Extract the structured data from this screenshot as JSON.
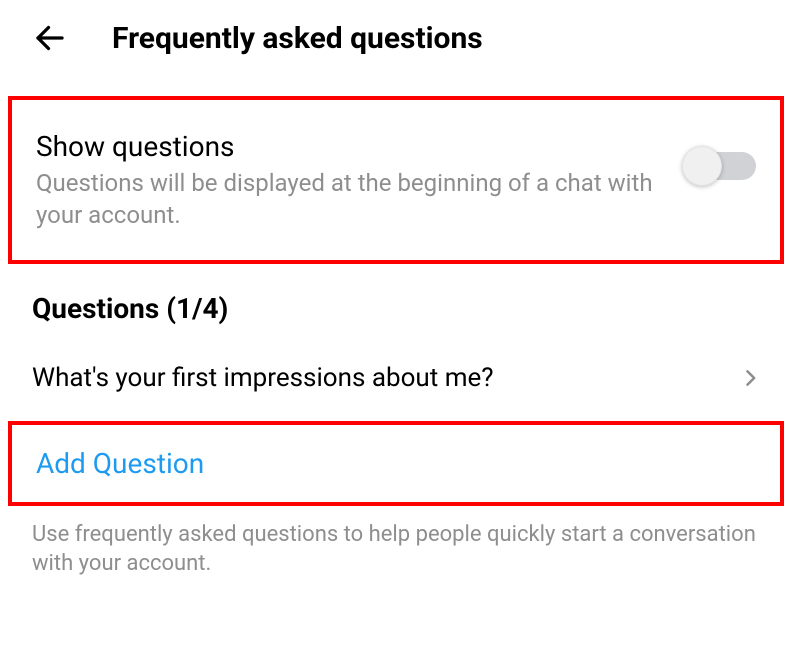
{
  "header": {
    "title": "Frequently asked questions"
  },
  "showQuestions": {
    "title": "Show questions",
    "description": "Questions will be displayed at the beginning of a chat with your account.",
    "enabled": false
  },
  "questionsCounter": "Questions (1/4)",
  "questions": [
    {
      "text": "What's your first impressions about me?"
    }
  ],
  "addQuestion": "Add Question",
  "footer": "Use frequently asked questions to help people quickly start a conversation with your account."
}
